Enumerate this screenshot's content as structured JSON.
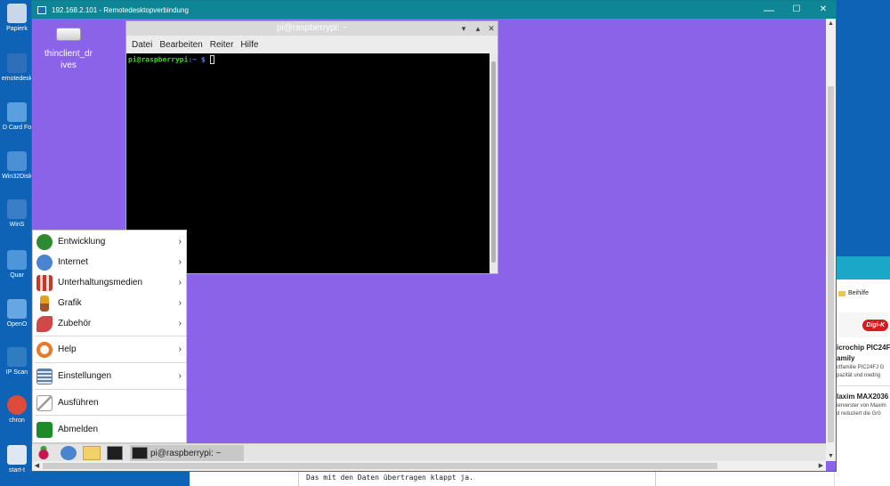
{
  "host": {
    "icons": [
      {
        "label": "Papierk",
        "color": "#c9d7e8"
      },
      {
        "label": "emotedesk",
        "color": "#2f6fb9"
      },
      {
        "label": "D Card Fo",
        "color": "#5aa0de"
      },
      {
        "label": "Win32Disk",
        "color": "#4b8fd5"
      },
      {
        "label": "WinS",
        "color": "#3a7ec8"
      },
      {
        "label": "Quar",
        "color": "#4e96da"
      },
      {
        "label": "OpenO",
        "color": "#66a6e3"
      },
      {
        "label": "IP Scan",
        "color": "#2f7cc0"
      },
      {
        "label": "chron",
        "color": "#e04a3a"
      },
      {
        "label": "start-t",
        "color": "#dfe8f2"
      }
    ],
    "right_panel": {
      "breadcrumb": "Beihilfe",
      "ad_brand": "Digi-K",
      "item1_title_a": "icrochip PIC24F",
      "item1_title_b": "amily",
      "item1_text_a": "ctfamilie PIC24FJ G",
      "item1_text_b": "pazität und niedrig",
      "item2_title": "laxim MAX2036",
      "item2_text_a": "ierverster von Maxim",
      "item2_text_b": "d reduziert die Grö"
    },
    "bottom_text": "Das mit den Daten übertragen klappt ja."
  },
  "rdp": {
    "title": "192.168.2.101 - Remotedesktopverbindung",
    "minimize": "—",
    "maximize": "☐",
    "close": "✕"
  },
  "pi": {
    "drive_label": "thinclient_drives",
    "terminal": {
      "title": "pi@raspberrypi: ~",
      "menu": [
        "Datei",
        "Bearbeiten",
        "Reiter",
        "Hilfe"
      ],
      "prompt_user": "pi@raspberrypi",
      "prompt_path": ":~",
      "prompt_symbol": "$"
    },
    "start_menu": [
      {
        "label": "Entwicklung",
        "icon": "development-icon",
        "color": "#2f8a2f",
        "submenu": true
      },
      {
        "label": "Internet",
        "icon": "globe-icon",
        "color": "#4a83cf",
        "submenu": true
      },
      {
        "label": "Unterhaltungsmedien",
        "icon": "multimedia-icon",
        "color": "#c0392b",
        "submenu": true
      },
      {
        "label": "Grafik",
        "icon": "paintbrush-icon",
        "color": "#e0a020",
        "submenu": true
      },
      {
        "label": "Zubehör",
        "icon": "accessories-icon",
        "color": "#d04848",
        "submenu": true
      },
      {
        "label": "Help",
        "icon": "help-lifebuoy-icon",
        "color": "#e8792c",
        "submenu": true
      },
      {
        "label": "Einstellungen",
        "icon": "settings-icon",
        "color": "#5d7fa8",
        "submenu": true
      },
      {
        "label": "Ausführen",
        "icon": "run-icon",
        "color": "#9a9a9a",
        "submenu": false
      },
      {
        "label": "Abmelden",
        "icon": "logout-icon",
        "color": "#1f8a2a",
        "submenu": false
      }
    ],
    "taskbar": {
      "task_label": "pi@raspberrypi: ~"
    }
  }
}
